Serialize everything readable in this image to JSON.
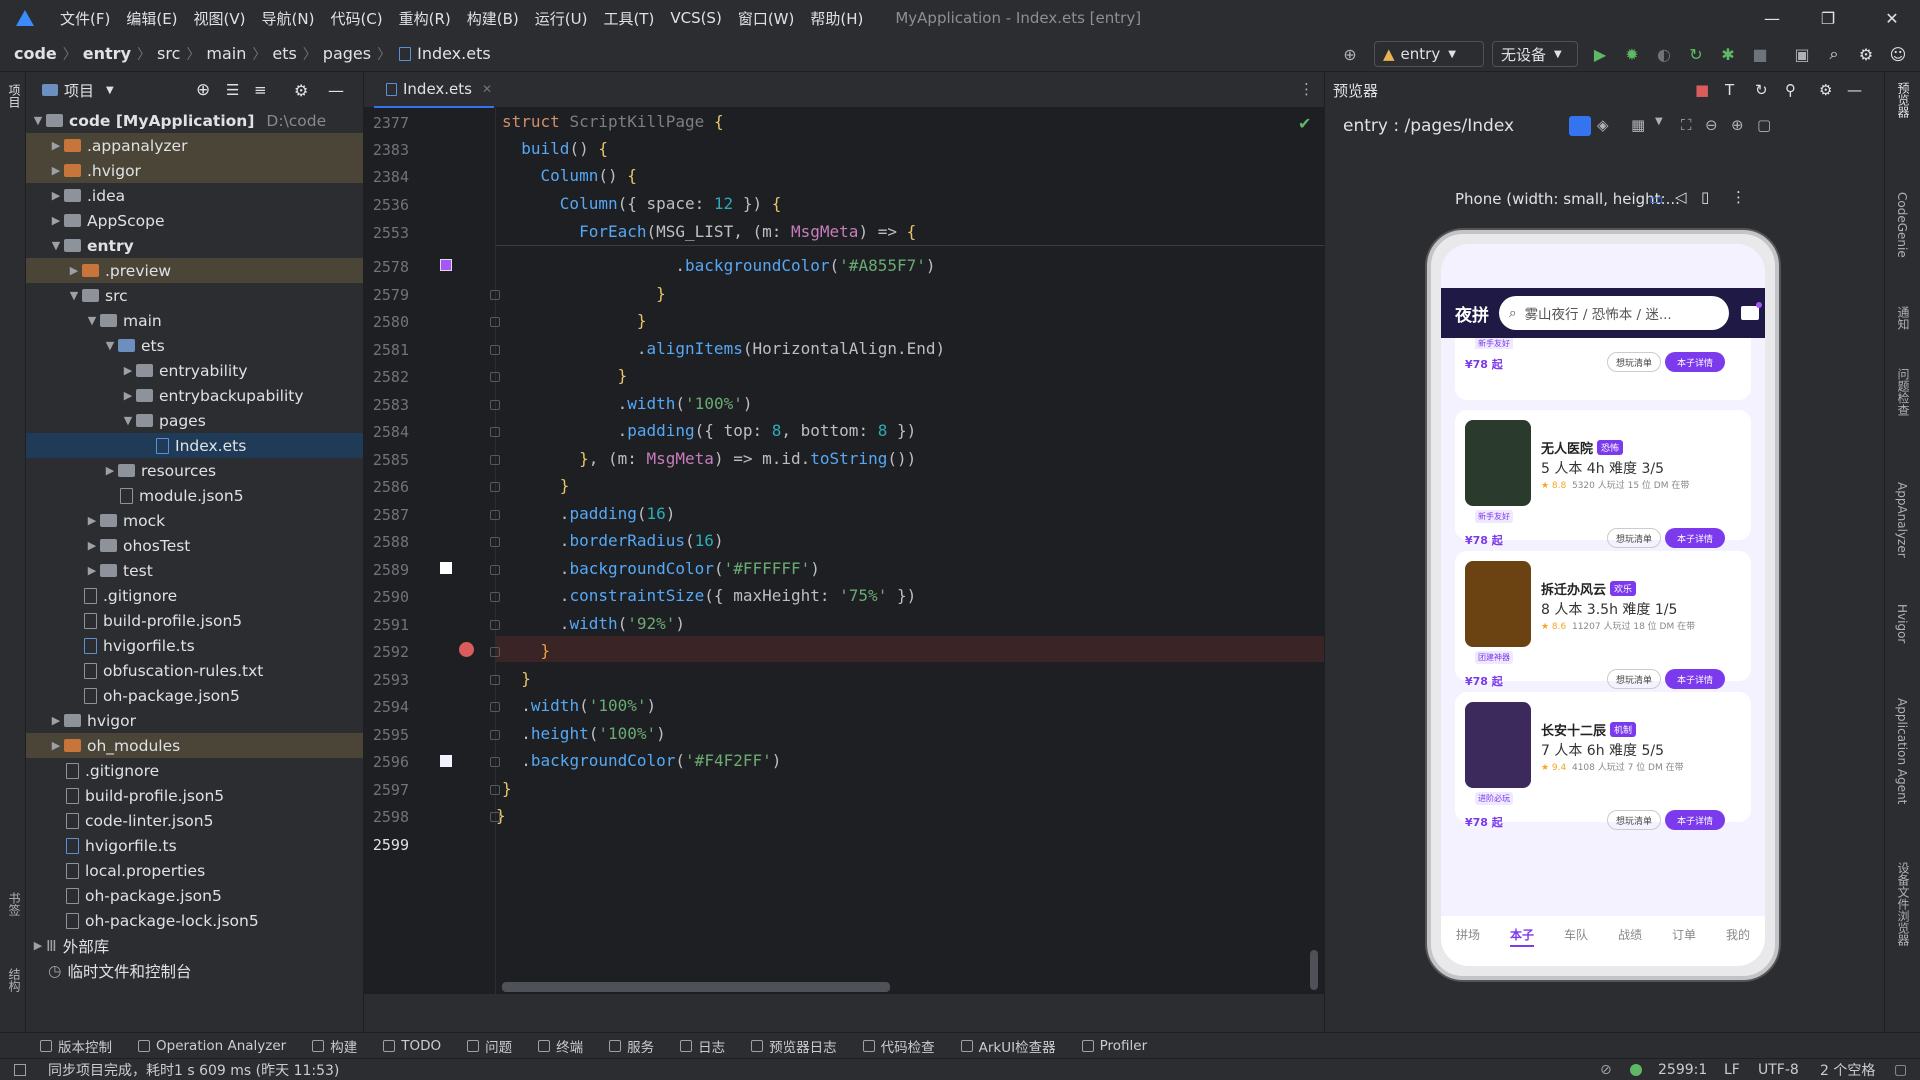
{
  "menubar": {
    "items": [
      "文件(F)",
      "编辑(E)",
      "视图(V)",
      "导航(N)",
      "代码(C)",
      "重构(R)",
      "构建(B)",
      "运行(U)",
      "工具(T)",
      "VCS(S)",
      "窗口(W)",
      "帮助(H)"
    ],
    "window_title": "MyApplication - Index.ets [entry]"
  },
  "breadcrumb": [
    "code",
    "entry",
    "src",
    "main",
    "ets",
    "pages",
    "Index.ets"
  ],
  "toolbar": {
    "module": "entry",
    "device": "无设备"
  },
  "left_strip": {
    "project": "项目",
    "bookmarks": "书签",
    "structure": "结构"
  },
  "project": {
    "title": "项目",
    "rows": [
      {
        "label": "code [MyApplication]",
        "extra": "D:\\code"
      },
      {
        "label": ".appanalyzer"
      },
      {
        "label": ".hvigor"
      },
      {
        "label": ".idea"
      },
      {
        "label": "AppScope"
      },
      {
        "label": "entry"
      },
      {
        "label": ".preview"
      },
      {
        "label": "src"
      },
      {
        "label": "main"
      },
      {
        "label": "ets"
      },
      {
        "label": "entryability"
      },
      {
        "label": "entrybackupability"
      },
      {
        "label": "pages"
      },
      {
        "label": "Index.ets"
      },
      {
        "label": "resources"
      },
      {
        "label": "module.json5"
      },
      {
        "label": "mock"
      },
      {
        "label": "ohosTest"
      },
      {
        "label": "test"
      },
      {
        "label": ".gitignore"
      },
      {
        "label": "build-profile.json5"
      },
      {
        "label": "hvigorfile.ts"
      },
      {
        "label": "obfuscation-rules.txt"
      },
      {
        "label": "oh-package.json5"
      },
      {
        "label": "hvigor"
      },
      {
        "label": "oh_modules"
      },
      {
        "label": ".gitignore"
      },
      {
        "label": "build-profile.json5"
      },
      {
        "label": "code-linter.json5"
      },
      {
        "label": "hvigorfile.ts"
      },
      {
        "label": "local.properties"
      },
      {
        "label": "oh-package.json5"
      },
      {
        "label": "oh-package-lock.json5"
      },
      {
        "label": "外部库"
      },
      {
        "label": "临时文件和控制台"
      }
    ]
  },
  "editor": {
    "tab": "Index.ets",
    "line_numbers": [
      "2377",
      "2383",
      "2384",
      "2536",
      "2553",
      "2578",
      "2579",
      "2580",
      "2581",
      "2582",
      "2583",
      "2584",
      "2585",
      "2586",
      "2587",
      "2588",
      "2589",
      "2590",
      "2591",
      "2592",
      "2593",
      "2594",
      "2595",
      "2596",
      "2597",
      "2598",
      "2599"
    ]
  },
  "preview": {
    "title": "预览器",
    "route": "entry : /pages/Index",
    "device": "Phone (width: small, height:..."
  },
  "app": {
    "title": "夜拼",
    "search": "雾山夜行 / 恐怖本 / 迷...",
    "top_partial_badge": "新手友好",
    "top_partial_price": "¥78 起",
    "btn_want": "想玩清单",
    "btn_detail": "本子详情",
    "cards": [
      {
        "name": "无人医院",
        "tag": "恐怖",
        "meta": "5 人本  4h  难度 3/5",
        "rating": "★ 8.8",
        "stats": "5320 人玩过   15 位 DM 在带",
        "badge": "新手友好",
        "price": "¥78 起",
        "color": "#2a3a2c"
      },
      {
        "name": "拆迁办风云",
        "tag": "欢乐",
        "meta": "8 人本  3.5h  难度 1/5",
        "rating": "★ 8.6",
        "stats": "11207 人玩过   18 位 DM 在带",
        "badge": "团建神器",
        "price": "¥78 起",
        "color": "#6b4313"
      },
      {
        "name": "长安十二辰",
        "tag": "机制",
        "meta": "7 人本  6h  难度 5/5",
        "rating": "★ 9.4",
        "stats": "4108 人玩过   7 位 DM 在带",
        "badge": "进阶必玩",
        "price": "¥78 起",
        "color": "#3c2a5c"
      }
    ],
    "tabs": [
      "拼场",
      "本子",
      "车队",
      "战绩",
      "订单",
      "我的"
    ]
  },
  "right_strip": [
    "预览器",
    "CodeGenie",
    "通知",
    "问题检查",
    "AppAnalyzer",
    "Hvigor",
    "Application Agent",
    "设备文件浏览器"
  ],
  "bottombar": [
    "版本控制",
    "Operation Analyzer",
    "构建",
    "TODO",
    "问题",
    "终端",
    "服务",
    "日志",
    "预览器日志",
    "代码检查",
    "ArkUI检查器",
    "Profiler"
  ],
  "status": {
    "message": "同步项目完成，耗时1 s 609 ms (昨天 11:53)",
    "position": "2599:1",
    "line_sep": "LF",
    "encoding": "UTF-8",
    "indent": "2 个空格"
  }
}
